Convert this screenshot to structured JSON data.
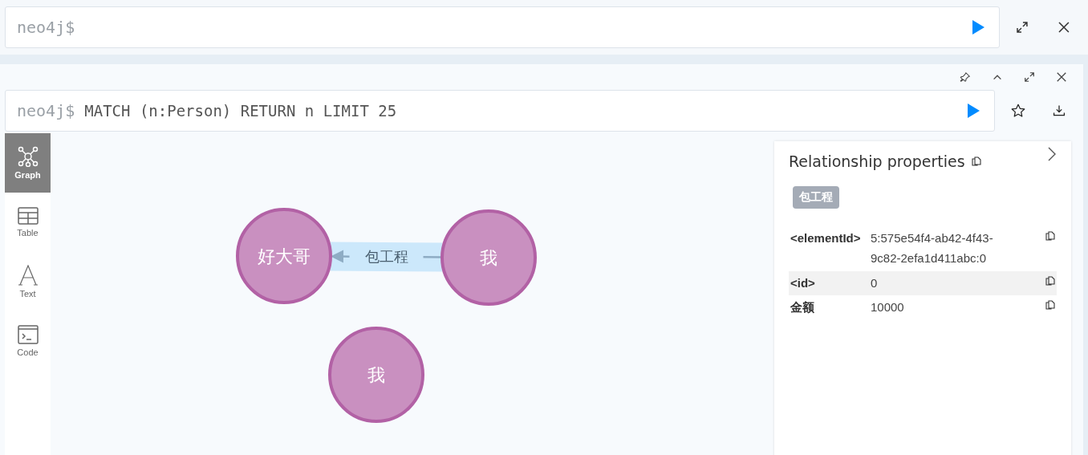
{
  "top_editor": {
    "prompt": "neo4j$"
  },
  "result_frame": {
    "prompt": "neo4j$",
    "query": "MATCH (n:Person) RETURN n LIMIT 25"
  },
  "sidebar": {
    "items": [
      {
        "label": "Graph",
        "kind": "graph",
        "selected": true
      },
      {
        "label": "Table",
        "kind": "table",
        "selected": false
      },
      {
        "label": "Text",
        "kind": "text",
        "selected": false
      },
      {
        "label": "Code",
        "kind": "code",
        "selected": false
      }
    ]
  },
  "graph": {
    "nodes": [
      {
        "label": "好大哥"
      },
      {
        "label": "我"
      },
      {
        "label": "我"
      }
    ],
    "relationships": [
      {
        "type": "包工程",
        "selected": true
      }
    ]
  },
  "properties_panel": {
    "title": "Relationship properties",
    "type_badge": "包工程",
    "rows": [
      {
        "key": "<elementId>",
        "value": "5:575e54f4-ab42-4f43-9c82-2efa1d411abc:0"
      },
      {
        "key": "<id>",
        "value": "0"
      },
      {
        "key": "金额",
        "value": "10000"
      }
    ]
  }
}
